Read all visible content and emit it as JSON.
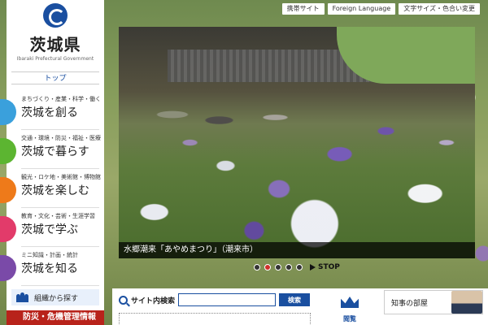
{
  "utility": {
    "mobile": "携帯サイト",
    "foreign": "Foreign Language",
    "textsize": "文字サイズ・色合い変更"
  },
  "header": {
    "title": "茨城県",
    "subtitle": "Ibaraki Prefectural Government",
    "top_link": "トップ"
  },
  "nav": {
    "items": [
      {
        "sub": "まちづくり・産業・科学・働く",
        "main": "茨城を創る",
        "color": "#3aa0dc"
      },
      {
        "sub": "交通・環境・防災・福祉・医療",
        "main": "茨城で暮らす",
        "color": "#5cb531"
      },
      {
        "sub": "観光・ロケ地・美術館・博物館",
        "main": "茨城を楽しむ",
        "color": "#ee7a1a"
      },
      {
        "sub": "教育・文化・芸術・生涯学習",
        "main": "茨城で学ぶ",
        "color": "#e23b6a"
      },
      {
        "sub": "ミニ知識・計画・統計",
        "main": "茨城を知る",
        "color": "#7a4aa8"
      }
    ]
  },
  "org_search": "組織から探す",
  "disaster": "防災・危機管理情報",
  "hero": {
    "caption": "水郷潮来「あやめまつり」（潮来市）",
    "stop_label": "STOP",
    "slide_count": 5,
    "active_slide": 2
  },
  "search": {
    "label": "サイト内検索",
    "placeholder": "",
    "button": "検索"
  },
  "reading": "閲覧",
  "governor": "知事の部屋"
}
